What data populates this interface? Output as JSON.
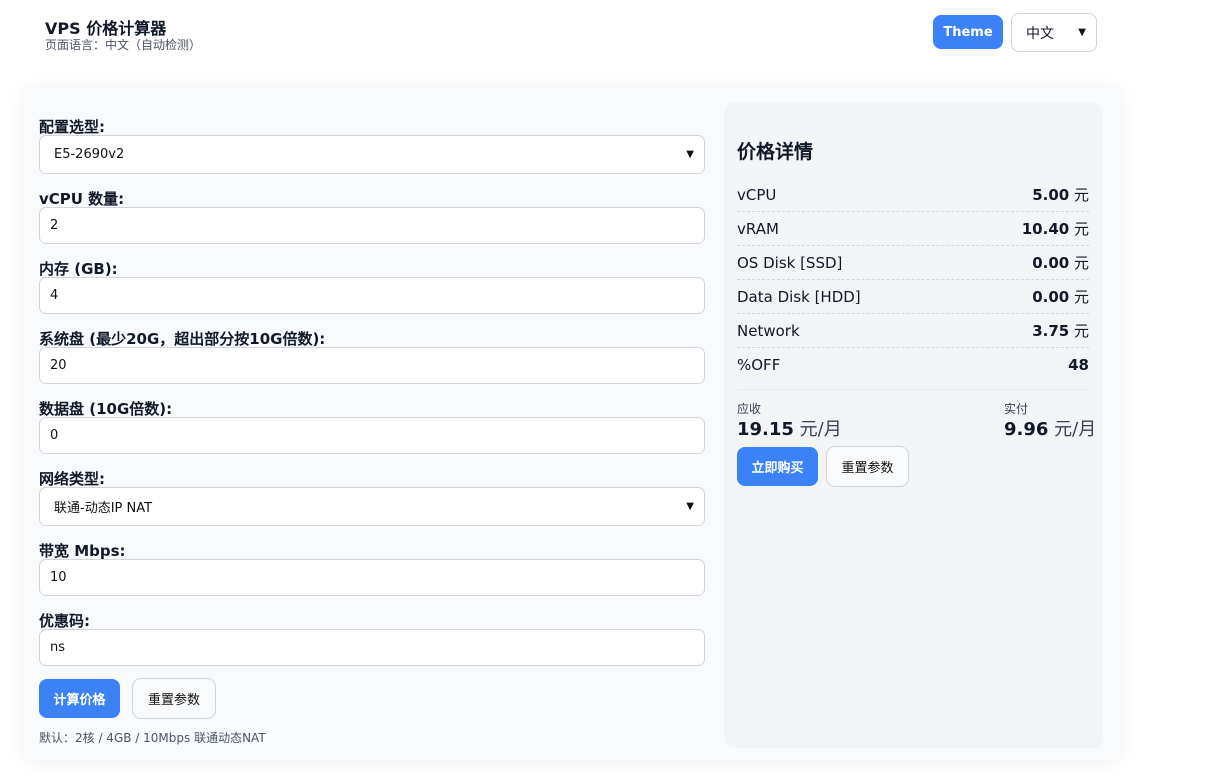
{
  "header": {
    "title": "VPS 价格计算器",
    "subtitle": "页面语言：中文（自动检测）",
    "theme_label": "Theme",
    "language_selected": "中文"
  },
  "form": {
    "config": {
      "label": "配置选型:",
      "value": "E5-2690v2"
    },
    "vcpu": {
      "label": "vCPU 数量:",
      "value": "2"
    },
    "memory": {
      "label": "内存 (GB):",
      "value": "4"
    },
    "os_disk": {
      "label": "系统盘 (最少20G，超出部分按10G倍数):",
      "value": "20"
    },
    "data_disk": {
      "label": "数据盘 (10G倍数):",
      "value": "0"
    },
    "network": {
      "label": "网络类型:",
      "value": "联通-动态IP NAT"
    },
    "bandwidth": {
      "label": "带宽 Mbps:",
      "value": "10"
    },
    "coupon": {
      "label": "优惠码:",
      "value": "ns"
    },
    "calc_label": "计算价格",
    "reset_label": "重置参数",
    "hint": "默认：2核 / 4GB / 10Mbps 联通动态NAT"
  },
  "details": {
    "title": "价格详情",
    "currency": "元",
    "rows": [
      {
        "name": "vCPU",
        "value": "5.00"
      },
      {
        "name": "vRAM",
        "value": "10.40"
      },
      {
        "name": "OS Disk [SSD]",
        "value": "0.00"
      },
      {
        "name": "Data Disk [HDD]",
        "value": "0.00"
      },
      {
        "name": "Network",
        "value": "3.75"
      }
    ],
    "discount": {
      "name": "%OFF",
      "value": "48"
    },
    "due": {
      "label": "应收",
      "value": "19.15",
      "unit": "元/月"
    },
    "actual": {
      "label": "实付",
      "value": "9.96",
      "unit": "元/月"
    },
    "buy_label": "立即购买",
    "reset_label": "重置参数"
  },
  "colors": {
    "accent": "#3b82f6",
    "panel": "#f3f4f6",
    "card": "#f8fafc"
  }
}
